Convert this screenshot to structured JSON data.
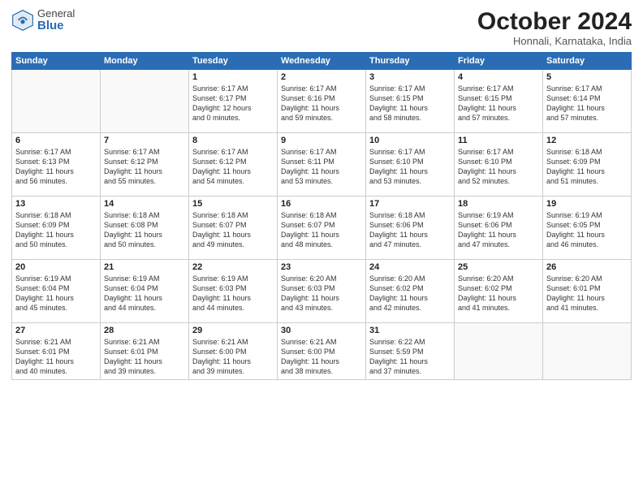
{
  "header": {
    "logo_general": "General",
    "logo_blue": "Blue",
    "month_title": "October 2024",
    "location": "Honnali, Karnataka, India"
  },
  "days_of_week": [
    "Sunday",
    "Monday",
    "Tuesday",
    "Wednesday",
    "Thursday",
    "Friday",
    "Saturday"
  ],
  "weeks": [
    [
      {
        "day": "",
        "text": ""
      },
      {
        "day": "",
        "text": ""
      },
      {
        "day": "1",
        "text": "Sunrise: 6:17 AM\nSunset: 6:17 PM\nDaylight: 12 hours\nand 0 minutes."
      },
      {
        "day": "2",
        "text": "Sunrise: 6:17 AM\nSunset: 6:16 PM\nDaylight: 11 hours\nand 59 minutes."
      },
      {
        "day": "3",
        "text": "Sunrise: 6:17 AM\nSunset: 6:15 PM\nDaylight: 11 hours\nand 58 minutes."
      },
      {
        "day": "4",
        "text": "Sunrise: 6:17 AM\nSunset: 6:15 PM\nDaylight: 11 hours\nand 57 minutes."
      },
      {
        "day": "5",
        "text": "Sunrise: 6:17 AM\nSunset: 6:14 PM\nDaylight: 11 hours\nand 57 minutes."
      }
    ],
    [
      {
        "day": "6",
        "text": "Sunrise: 6:17 AM\nSunset: 6:13 PM\nDaylight: 11 hours\nand 56 minutes."
      },
      {
        "day": "7",
        "text": "Sunrise: 6:17 AM\nSunset: 6:12 PM\nDaylight: 11 hours\nand 55 minutes."
      },
      {
        "day": "8",
        "text": "Sunrise: 6:17 AM\nSunset: 6:12 PM\nDaylight: 11 hours\nand 54 minutes."
      },
      {
        "day": "9",
        "text": "Sunrise: 6:17 AM\nSunset: 6:11 PM\nDaylight: 11 hours\nand 53 minutes."
      },
      {
        "day": "10",
        "text": "Sunrise: 6:17 AM\nSunset: 6:10 PM\nDaylight: 11 hours\nand 53 minutes."
      },
      {
        "day": "11",
        "text": "Sunrise: 6:17 AM\nSunset: 6:10 PM\nDaylight: 11 hours\nand 52 minutes."
      },
      {
        "day": "12",
        "text": "Sunrise: 6:18 AM\nSunset: 6:09 PM\nDaylight: 11 hours\nand 51 minutes."
      }
    ],
    [
      {
        "day": "13",
        "text": "Sunrise: 6:18 AM\nSunset: 6:09 PM\nDaylight: 11 hours\nand 50 minutes."
      },
      {
        "day": "14",
        "text": "Sunrise: 6:18 AM\nSunset: 6:08 PM\nDaylight: 11 hours\nand 50 minutes."
      },
      {
        "day": "15",
        "text": "Sunrise: 6:18 AM\nSunset: 6:07 PM\nDaylight: 11 hours\nand 49 minutes."
      },
      {
        "day": "16",
        "text": "Sunrise: 6:18 AM\nSunset: 6:07 PM\nDaylight: 11 hours\nand 48 minutes."
      },
      {
        "day": "17",
        "text": "Sunrise: 6:18 AM\nSunset: 6:06 PM\nDaylight: 11 hours\nand 47 minutes."
      },
      {
        "day": "18",
        "text": "Sunrise: 6:19 AM\nSunset: 6:06 PM\nDaylight: 11 hours\nand 47 minutes."
      },
      {
        "day": "19",
        "text": "Sunrise: 6:19 AM\nSunset: 6:05 PM\nDaylight: 11 hours\nand 46 minutes."
      }
    ],
    [
      {
        "day": "20",
        "text": "Sunrise: 6:19 AM\nSunset: 6:04 PM\nDaylight: 11 hours\nand 45 minutes."
      },
      {
        "day": "21",
        "text": "Sunrise: 6:19 AM\nSunset: 6:04 PM\nDaylight: 11 hours\nand 44 minutes."
      },
      {
        "day": "22",
        "text": "Sunrise: 6:19 AM\nSunset: 6:03 PM\nDaylight: 11 hours\nand 44 minutes."
      },
      {
        "day": "23",
        "text": "Sunrise: 6:20 AM\nSunset: 6:03 PM\nDaylight: 11 hours\nand 43 minutes."
      },
      {
        "day": "24",
        "text": "Sunrise: 6:20 AM\nSunset: 6:02 PM\nDaylight: 11 hours\nand 42 minutes."
      },
      {
        "day": "25",
        "text": "Sunrise: 6:20 AM\nSunset: 6:02 PM\nDaylight: 11 hours\nand 41 minutes."
      },
      {
        "day": "26",
        "text": "Sunrise: 6:20 AM\nSunset: 6:01 PM\nDaylight: 11 hours\nand 41 minutes."
      }
    ],
    [
      {
        "day": "27",
        "text": "Sunrise: 6:21 AM\nSunset: 6:01 PM\nDaylight: 11 hours\nand 40 minutes."
      },
      {
        "day": "28",
        "text": "Sunrise: 6:21 AM\nSunset: 6:01 PM\nDaylight: 11 hours\nand 39 minutes."
      },
      {
        "day": "29",
        "text": "Sunrise: 6:21 AM\nSunset: 6:00 PM\nDaylight: 11 hours\nand 39 minutes."
      },
      {
        "day": "30",
        "text": "Sunrise: 6:21 AM\nSunset: 6:00 PM\nDaylight: 11 hours\nand 38 minutes."
      },
      {
        "day": "31",
        "text": "Sunrise: 6:22 AM\nSunset: 5:59 PM\nDaylight: 11 hours\nand 37 minutes."
      },
      {
        "day": "",
        "text": ""
      },
      {
        "day": "",
        "text": ""
      }
    ]
  ]
}
